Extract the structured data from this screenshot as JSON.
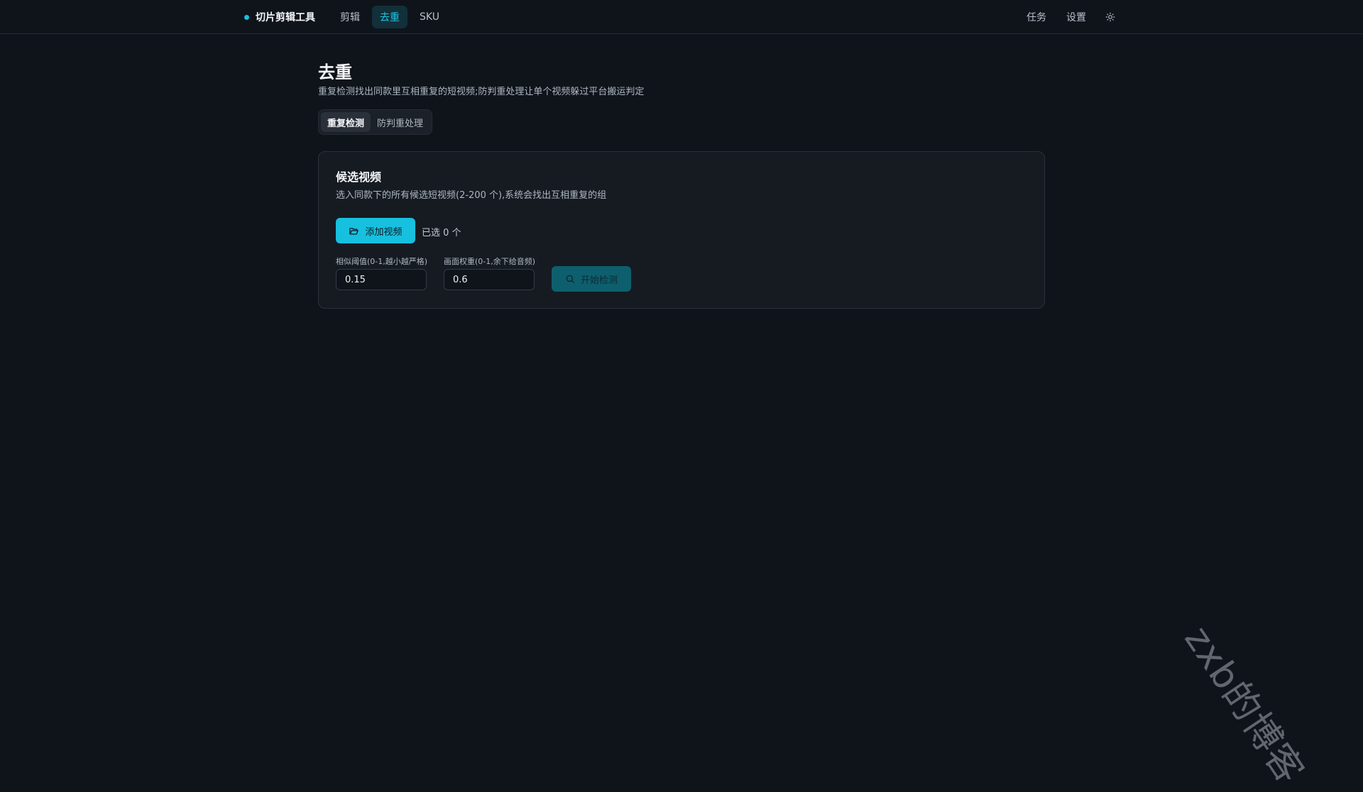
{
  "header": {
    "brand": "切片剪辑工具",
    "tabs": [
      {
        "label": "剪辑",
        "active": false
      },
      {
        "label": "去重",
        "active": true
      },
      {
        "label": "SKU",
        "active": false
      }
    ],
    "right_links": [
      "任务",
      "设置"
    ],
    "theme_icon": "sun-icon"
  },
  "page": {
    "title": "去重",
    "subtitle": "重复检测找出同款里互相重复的短视频;防判重处理让单个视频躲过平台搬运判定",
    "segments": [
      {
        "label": "重复检测",
        "active": true
      },
      {
        "label": "防判重处理",
        "active": false
      }
    ]
  },
  "card": {
    "title": "候选视频",
    "description": "选入同款下的所有候选短视频(2-200 个),系统会找出互相重复的组",
    "add_button": "添加视频",
    "add_icon": "folder-open-icon",
    "selected_text": "已选 0 个",
    "threshold_label": "相似阈值(0-1,越小越严格)",
    "threshold_value": "0.15",
    "weight_label": "画面权重(0-1,余下给音频)",
    "weight_value": "0.6",
    "start_button": "开始检测",
    "start_icon": "search-icon"
  },
  "watermark": "zxb的博客",
  "colors": {
    "background": "#0f141b",
    "accent": "#17c0df",
    "accent_dim": "#0e5f6e",
    "card": "#161b22"
  }
}
